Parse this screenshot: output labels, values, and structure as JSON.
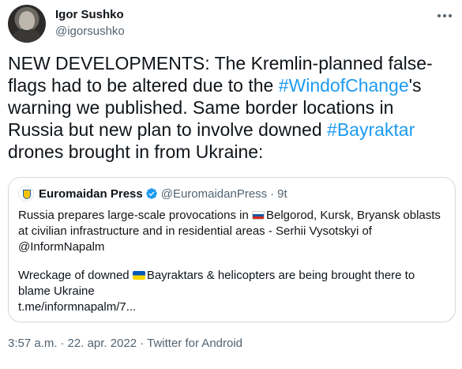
{
  "author": {
    "name": "Igor Sushko",
    "handle": "@igorsushko"
  },
  "tweet": {
    "segment_1": "NEW DEVELOPMENTS: The Kremlin-planned false-flags had to be altered due to the ",
    "hashtag_1": "#WindofChange",
    "segment_2": "'s warning we published. Same border locations in Russia but new plan to involve downed ",
    "hashtag_2": "#Bayraktar",
    "segment_3": " drones brought in from Ukraine:"
  },
  "quote": {
    "name": "Euromaidan Press",
    "handle": "@EuromaidanPress",
    "separator": "·",
    "time": "9t",
    "para1_a": "Russia prepares large-scale provocations in ",
    "para1_b": "Belgorod, Kursk, Bryansk oblasts at civilian infrastructure and in residential areas - Serhii Vysotskyi of @InformNapalm",
    "para2_a": "Wreckage of downed ",
    "para2_b": "Bayraktars & helicopters are being brought there to blame Ukraine",
    "link": "t.me/informnapalm/7..."
  },
  "meta": {
    "time": "3:57 a.m.",
    "date": "22. apr. 2022",
    "source": "Twitter for Android",
    "separator": "·"
  },
  "colors": {
    "hashtag": "#1d9bf0",
    "secondary_text": "#536471",
    "border": "#cfd9de"
  },
  "icons": [
    "more-icon",
    "verified-badge-icon",
    "russia-flag-icon",
    "ukraine-flag-icon"
  ]
}
